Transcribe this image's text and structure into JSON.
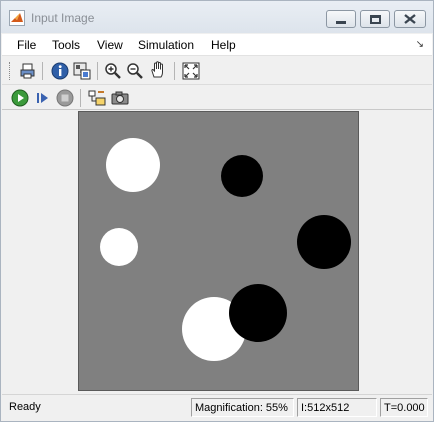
{
  "window": {
    "title": "Input Image"
  },
  "menu": {
    "items": [
      "File",
      "Tools",
      "View",
      "Simulation",
      "Help"
    ],
    "dock_glyph": "↘"
  },
  "toolbar": {
    "row1_icons": [
      "print-icon",
      "info-icon",
      "pixel-region-icon",
      "zoom-in-icon",
      "zoom-out-icon",
      "pan-hand-icon",
      "fit-to-window-icon"
    ],
    "row2_icons": [
      "start-simulation-icon",
      "step-forward-icon",
      "stop-icon",
      "highlight-simulink-block-icon",
      "snapshot-camera-icon"
    ]
  },
  "image": {
    "background": "#808080",
    "circles": [
      {
        "color": "white"
      },
      {
        "color": "black"
      },
      {
        "color": "white"
      },
      {
        "color": "black"
      },
      {
        "color": "white"
      },
      {
        "color": "black"
      }
    ]
  },
  "status": {
    "state": "Ready",
    "magnification": "Magnification: 55%",
    "image_size": "I:512x512",
    "time": "T=0.000"
  }
}
